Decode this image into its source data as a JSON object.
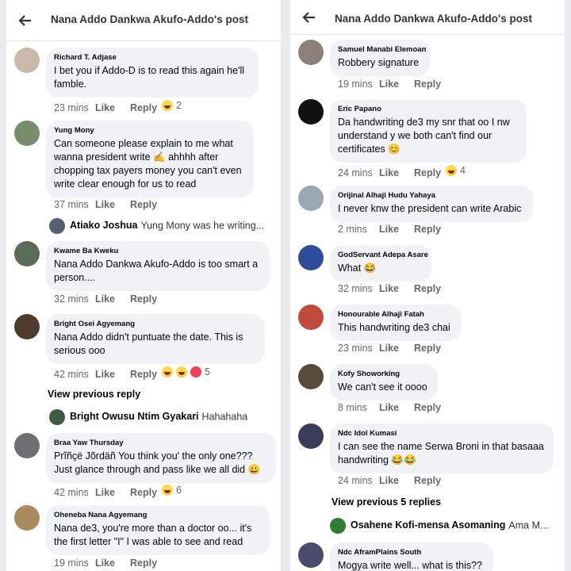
{
  "left": {
    "header_title": "Nana Addo Dankwa Akufo-Addo's post",
    "comments": [
      {
        "name": "Richard T. Adjase",
        "text": "I bet you if Addo-D is to read this again he'll famble.",
        "time": "23 mins",
        "like": "Like",
        "reply": "Reply",
        "react_count": "2",
        "avatar_color": "#c9b9a8"
      },
      {
        "name": "Yung Mony",
        "text": "Can someone please explain to me what wanna president write ✍️ ahhhh after chopping tax payers money you can't even write clear enough for us to read",
        "time": "37 mins",
        "like": "Like",
        "reply": "Reply",
        "react_count": "",
        "avatar_color": "#7a8c6e"
      },
      {
        "name": "Kwame Ba Kweku",
        "text": "Nana Addo Dankwa Akufo-Addo is too smart a person....",
        "time": "32 mins",
        "like": "Like",
        "reply": "Reply",
        "react_count": "",
        "avatar_color": "#5b6b5a"
      },
      {
        "name": "Bright Osei Agyemang",
        "text": "Nana Addo didn't puntuate the date. This is serious ooo",
        "time": "42 mins",
        "like": "Like",
        "reply": "Reply",
        "react_count": "5",
        "avatar_color": "#4d3b2e"
      },
      {
        "name": "Braa Yaw Thursday",
        "text": "Prĩñçë Jõrdäñ You think you' the only one??? Just glance through and pass like we all did 😀",
        "time": "42 mins",
        "like": "Like",
        "reply": "Reply",
        "react_count": "6",
        "avatar_color": "#6f6f72"
      },
      {
        "name": "Oheneba Nana Agyemang",
        "text": "Nana de3, you're more than a doctor oo... it's the first letter \"I\" I was able to see and read",
        "time": "19 mins",
        "like": "Like",
        "reply": "Reply",
        "react_count": "",
        "avatar_color": "#a88b5e"
      }
    ],
    "replies": [
      {
        "name": "Atiako Joshua",
        "text": "Yung Mony was he writing...",
        "avatar_color": "#556070"
      },
      {
        "name": "Bright Owusu Ntim Gyakari",
        "text": "Hahahaha",
        "avatar_color": "#3e5b44"
      }
    ],
    "view_previous": "View previous reply"
  },
  "right": {
    "header_title": "Nana Addo Dankwa Akufo-Addo's post",
    "comments": [
      {
        "name": "Samuel Manabi Elemoan",
        "text": "Robbery signature",
        "time": "19 mins",
        "like": "Like",
        "reply": "Reply",
        "react_count": "",
        "avatar_color": "#8d7f7a"
      },
      {
        "name": "Eric Papano",
        "text": "Da handwriting de3 my snr that oo I nw understand y we both can't find our certificates 😊",
        "time": "24 mins",
        "like": "Like",
        "reply": "Reply",
        "react_count": "4",
        "avatar_color": "#111111"
      },
      {
        "name": "Orijinal Alhaji Hudu Yahaya",
        "text": "I never knw the president can write Arabic",
        "time": "2 mins",
        "like": "Like",
        "reply": "Reply",
        "react_count": "",
        "avatar_color": "#9aa7b5"
      },
      {
        "name": "GodServant Adepa Asare",
        "text": "What 😂",
        "time": "32 mins",
        "like": "Like",
        "reply": "Reply",
        "react_count": "",
        "avatar_color": "#2d4c9a"
      },
      {
        "name": "Honourable Alhaji Fatah",
        "text": "This handwriting de3 chai",
        "time": "23 mins",
        "like": "Like",
        "reply": "Reply",
        "react_count": "",
        "avatar_color": "#c24a3c"
      },
      {
        "name": "Kofy Showorking",
        "text": "We can't see it oooo",
        "time": "8 mins",
        "like": "Like",
        "reply": "Reply",
        "react_count": "",
        "avatar_color": "#5a4a3a"
      },
      {
        "name": "Ndc Idol Kumasi",
        "text": "I can see the name Serwa Broni in that basaaa handwriting 😂😂",
        "time": "24 mins",
        "like": "Like",
        "reply": "Reply",
        "react_count": "",
        "avatar_color": "#3b3b5a"
      },
      {
        "name": "Ndc AframPlains South",
        "text": "Mogya write well... what is this??",
        "time": "",
        "like": "",
        "reply": "",
        "react_count": "",
        "avatar_color": "#4a4a6a"
      }
    ],
    "view_previous": "View previous 5 replies",
    "reply": {
      "name": "Osahene Kofi-mensa Asomaning",
      "text": "Ama M...",
      "avatar_color": "#2e7d32"
    }
  },
  "colors": {
    "bubble": "#f0f2f5",
    "meta": "#65676b",
    "heart": "#f33e58"
  }
}
